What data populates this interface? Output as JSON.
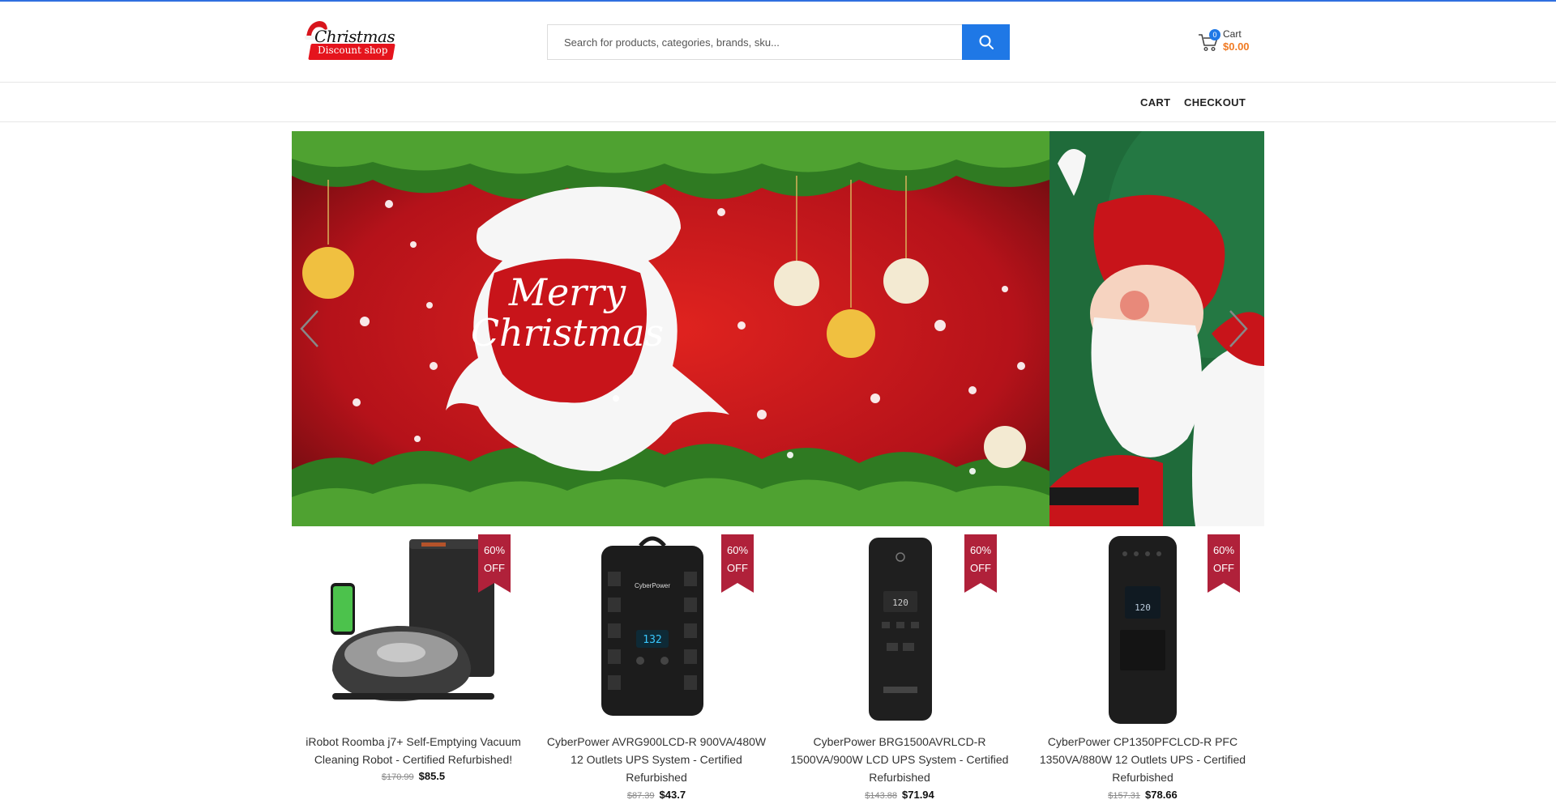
{
  "header": {
    "logo": {
      "title": "Christmas",
      "subtitle": "Discount shop"
    },
    "search": {
      "placeholder": "Search for products, categories, brands, sku..."
    },
    "cart": {
      "count": "0",
      "label": "Cart",
      "total": "$0.00"
    }
  },
  "nav": {
    "items": [
      "CART",
      "CHECKOUT"
    ]
  },
  "banner": {
    "current_slide_text": "Merry Christmas",
    "icons": {
      "prev": "chevron-left-icon",
      "next": "chevron-right-icon"
    }
  },
  "products": [
    {
      "title": "iRobot Roomba j7+ Self-Emptying Vacuum Cleaning Robot - Certified Refurbished!",
      "old_price": "$170.99",
      "price": "$85.5",
      "discount_pct": "60%",
      "discount_off": "OFF"
    },
    {
      "title": "CyberPower AVRG900LCD-R 900VA/480W 12 Outlets UPS System - Certified Refurbished",
      "old_price": "$87.39",
      "price": "$43.7",
      "discount_pct": "60%",
      "discount_off": "OFF"
    },
    {
      "title": "CyberPower BRG1500AVRLCD-R 1500VA/900W LCD UPS System - Certified Refurbished",
      "old_price": "$143.88",
      "price": "$71.94",
      "discount_pct": "60%",
      "discount_off": "OFF"
    },
    {
      "title": "CyberPower CP1350PFCLCD-R PFC 1350VA/880W 12 Outlets UPS - Certified Refurbished",
      "old_price": "$157.31",
      "price": "$78.66",
      "discount_pct": "60%",
      "discount_off": "OFF"
    }
  ],
  "colors": {
    "accent": "#1f78e6",
    "cart_total": "#f07a22",
    "badge": "#b0213a",
    "banner_red": "#c8141a",
    "banner_green": "#1f6b3a"
  }
}
